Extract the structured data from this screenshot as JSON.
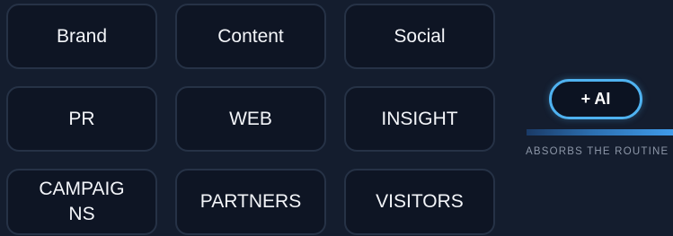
{
  "tiles": {
    "brand": "Brand",
    "content": "Content",
    "social": "Social",
    "pr": "PR",
    "web": "WEB",
    "insight": "INSIGHT",
    "campaigns": "CAMPAIGNS",
    "partners": "PARTNERS",
    "visitors": "VISITORS"
  },
  "ai": {
    "button_label": "+ AI",
    "caption": "ABSORBS THE ROUTINE"
  },
  "colors": {
    "background": "#141d2e",
    "tile_fill": "#0e1524",
    "tile_border": "#263246",
    "accent": "#4fb2f0"
  }
}
